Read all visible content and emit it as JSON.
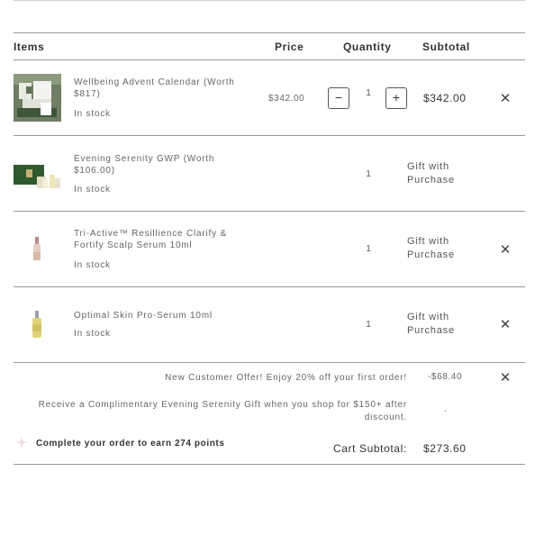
{
  "header": {
    "items": "Items",
    "price": "Price",
    "quantity": "Quantity",
    "subtotal": "Subtotal"
  },
  "items": [
    {
      "name": "Wellbeing Advent Calendar (Worth $817)",
      "stock": "In stock",
      "price": "$342.00",
      "quantity": "1",
      "subtotal": "$342.00",
      "decrement": "−",
      "increment": "+",
      "remove": "✕"
    },
    {
      "name": "Evening Serenity GWP (Worth $106.00)",
      "stock": "In stock",
      "quantity": "1",
      "subtotal": "Gift with Purchase"
    },
    {
      "name": "Tri-Active™ Resillience Clarify & Fortify Scalp Serum 10ml",
      "stock": "In stock",
      "quantity": "1",
      "subtotal": "Gift with Purchase",
      "remove": "✕"
    },
    {
      "name": "Optimal Skin Pro-Serum 10ml",
      "stock": "In stock",
      "quantity": "1",
      "subtotal": "Gift with Purchase",
      "remove": "✕"
    }
  ],
  "summary": {
    "offer": "New Customer Offer! Enjoy 20% off your first order!",
    "offer_value": "-$68.40",
    "offer_remove": "✕",
    "promo": "Receive a Complimentary Evening Serenity Gift when you shop for $150+ after discount.",
    "promo_value": "-",
    "points": "Complete your order to earn 274 points",
    "cart_label": "Cart Subtotal:",
    "cart_value": "$273.60"
  },
  "icons": {
    "remove": "close-icon",
    "points": "points-star-icon"
  },
  "colors": {
    "border": "#9a9a9a",
    "text": "#333333",
    "muted": "#666666"
  }
}
